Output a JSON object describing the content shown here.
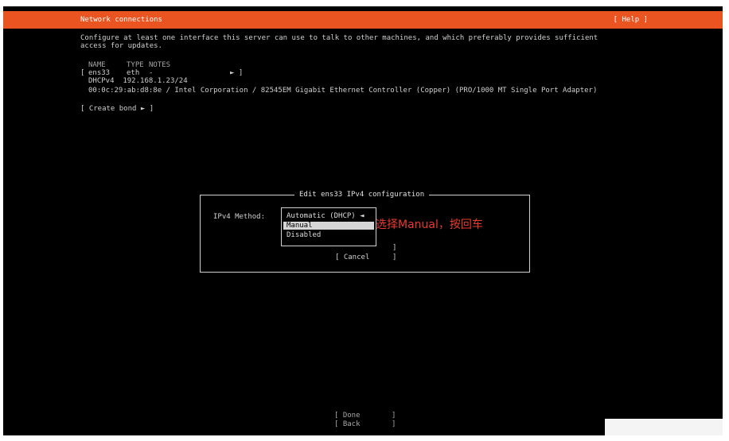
{
  "header": {
    "title": "Network connections",
    "help": "[ Help ]"
  },
  "intro": {
    "line1": "Configure at least one interface this server can use to talk to other machines, and which preferably provides sufficient",
    "line2": "access for updates."
  },
  "table": {
    "headers": {
      "name": "NAME",
      "type": "TYPE",
      "notes": "NOTES"
    },
    "row": {
      "open": "[",
      "name": "ens33",
      "type": "eth",
      "notes": "-",
      "arrow": "► ]"
    },
    "dhcp": "DHCPv4  192.168.1.23/24",
    "mac": "00:0c:29:ab:d8:8e / Intel Corporation / 82545EM Gigabit Ethernet Controller (Copper) (PRO/1000 MT Single Port Adapter)"
  },
  "create_bond": "[ Create bond ► ]",
  "dialog": {
    "title": "Edit ens33 IPv4 configuration",
    "method_label": "IPv4 Method:",
    "options": [
      {
        "label": "Automatic (DHCP) ◄"
      },
      {
        "label": "Manual",
        "selected": true
      },
      {
        "label": "Disabled"
      }
    ],
    "bracket1": "]",
    "cancel": "[ Cancel",
    "bracket2": "]"
  },
  "annotation": "选择Manual，按回车",
  "footer": {
    "done_open": "[ Done",
    "done_close": "]",
    "back_open": "[ Back",
    "back_close": "]"
  },
  "colors": {
    "accent": "#e95420",
    "annotation": "#e83a2d"
  }
}
